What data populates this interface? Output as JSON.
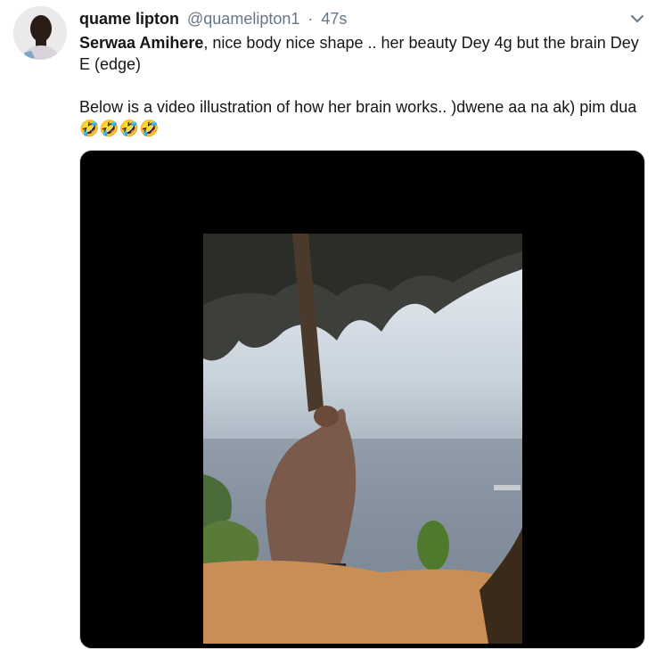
{
  "tweet": {
    "author_name": "quame lipton",
    "author_handle": "@quamelipton1",
    "separator": "·",
    "timestamp": "47s",
    "mention": "Serwaa Amihere",
    "line1_rest": ", nice body nice shape .. her beauty Dey 4g but the brain Dey E (edge)",
    "line2": "Below is a video illustration of how her brain works.. )dwene aa na ak) pim dua ",
    "emojis": "🤣🤣🤣🤣"
  },
  "icons": {
    "caret": "chevron-down-icon",
    "media_badge": "gif-icon"
  },
  "colors": {
    "text": "#14171a",
    "secondary": "#657786",
    "media_bg": "#000000"
  }
}
